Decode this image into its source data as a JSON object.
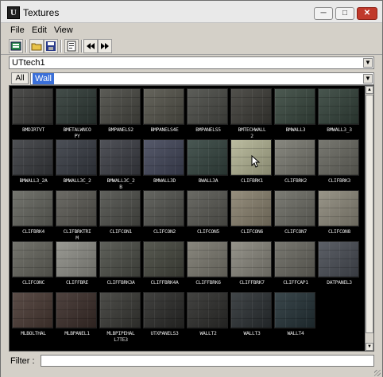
{
  "window": {
    "title": "Textures",
    "app_icon_letter": "U"
  },
  "window_controls": {
    "minimize": "─",
    "maximize": "□",
    "close": "✕"
  },
  "menu": {
    "items": [
      "File",
      "Edit",
      "View"
    ]
  },
  "toolbar": {
    "buttons": [
      "new-icon",
      "open-folder-icon",
      "save-icon",
      "properties-icon",
      "prev-icon",
      "next-icon"
    ]
  },
  "package_combo": {
    "value": "UTtech1"
  },
  "group_row": {
    "all_label": "All",
    "group_value": "Wall"
  },
  "filter": {
    "label": "Filter :",
    "value": ""
  },
  "textures": [
    {
      "name": "BMDIRTVT",
      "color": "#3a3a38"
    },
    {
      "name": "BMETALWNCOPY",
      "color": "#2f3a36"
    },
    {
      "name": "BMPANELS2",
      "color": "#4a4a44"
    },
    {
      "name": "BMPANELS4E",
      "color": "#55544b"
    },
    {
      "name": "BMPANELS5",
      "color": "#4b4c47"
    },
    {
      "name": "BMTECHWALL2",
      "color": "#3e3d38"
    },
    {
      "name": "BMWALL3",
      "color": "#39483f"
    },
    {
      "name": "BMWALL3_3",
      "color": "#34433b"
    },
    {
      "name": "BMWALL3_2A",
      "color": "#3a3c40"
    },
    {
      "name": "BMWALL3C_2",
      "color": "#383c44"
    },
    {
      "name": "BMWALL3C_2B",
      "color": "#3d3f46"
    },
    {
      "name": "BMWALL3D",
      "color": "#43475a"
    },
    {
      "name": "BWALL3A",
      "color": "#354540"
    },
    {
      "name": "CLIFBRK1",
      "color": "#b4b595"
    },
    {
      "name": "CLIFBRK2",
      "color": "#7b7b72"
    },
    {
      "name": "CLIFBRK3",
      "color": "#6a6a62"
    },
    {
      "name": "CLIFBRK4",
      "color": "#65665f"
    },
    {
      "name": "CLIFBRKTRIM",
      "color": "#5c5b55"
    },
    {
      "name": "CLIFCON1",
      "color": "#4f504b"
    },
    {
      "name": "CLIFCON2",
      "color": "#545550"
    },
    {
      "name": "CLIFCON5",
      "color": "#5a5a54"
    },
    {
      "name": "CLIFCON6",
      "color": "#8a826f"
    },
    {
      "name": "CLIFCON7",
      "color": "#6e6e66"
    },
    {
      "name": "CLIFCON8",
      "color": "#8e8a7c"
    },
    {
      "name": "CLIFCONC",
      "color": "#66665e"
    },
    {
      "name": "CLIFFBRE",
      "color": "#8f8f88"
    },
    {
      "name": "CLIFFBRK3A",
      "color": "#4d4f48"
    },
    {
      "name": "CLIFFBRK4A",
      "color": "#46483f"
    },
    {
      "name": "CLIFFBRK6",
      "color": "#7c7a70"
    },
    {
      "name": "CLIFFBRK7",
      "color": "#8a887e"
    },
    {
      "name": "CLIFFCAP1",
      "color": "#6b6a62"
    },
    {
      "name": "DATPANEL3",
      "color": "#4a4e56"
    },
    {
      "name": "MLBOLTHAL",
      "color": "#4a3a34"
    },
    {
      "name": "MLBPANEL1",
      "color": "#3c2e2a"
    },
    {
      "name": "MLBPIPEHALL7TE3",
      "color": "#3a3a36"
    },
    {
      "name": "UTXPANELS3",
      "color": "#2c2c2a"
    },
    {
      "name": "WALLT2",
      "color": "#2e2e2c"
    },
    {
      "name": "WALLT3",
      "color": "#2c3134"
    },
    {
      "name": "WALLT4",
      "color": "#253338"
    }
  ],
  "labels_display": [
    "BMDIRTVT",
    "BMETALWNCO\nPY",
    "BMPANELS2",
    "BMPANELS4E",
    "BMPANELS5",
    "BMTECHWALL\n2",
    "BMWALL3",
    "BMWALL3_3",
    "BMWALL3_2A",
    "BMWALL3C_2",
    "BMWALL3C_2\nB",
    "BMWALL3D",
    "BWALL3A",
    "CLIFBRK1",
    "CLIFBRK2",
    "CLIFBRK3",
    "CLIFBRK4",
    "CLIFBRKTRI\nM",
    "CLIFCON1",
    "CLIFCON2",
    "CLIFCON5",
    "CLIFCON6",
    "CLIFCON7",
    "CLIFCON8",
    "CLIFCONC",
    "CLIFFBRE",
    "CLIFFBRK3A",
    "CLIFFBRK4A",
    "CLIFFBRK6",
    "CLIFFBRK7",
    "CLIFFCAP1",
    "DATPANEL3",
    "MLBOLTHAL",
    "MLBPANEL1",
    "MLBPIPEHAL\nL7TE3",
    "UTXPANELS3",
    "WALLT2",
    "WALLT3",
    "WALLT4"
  ]
}
